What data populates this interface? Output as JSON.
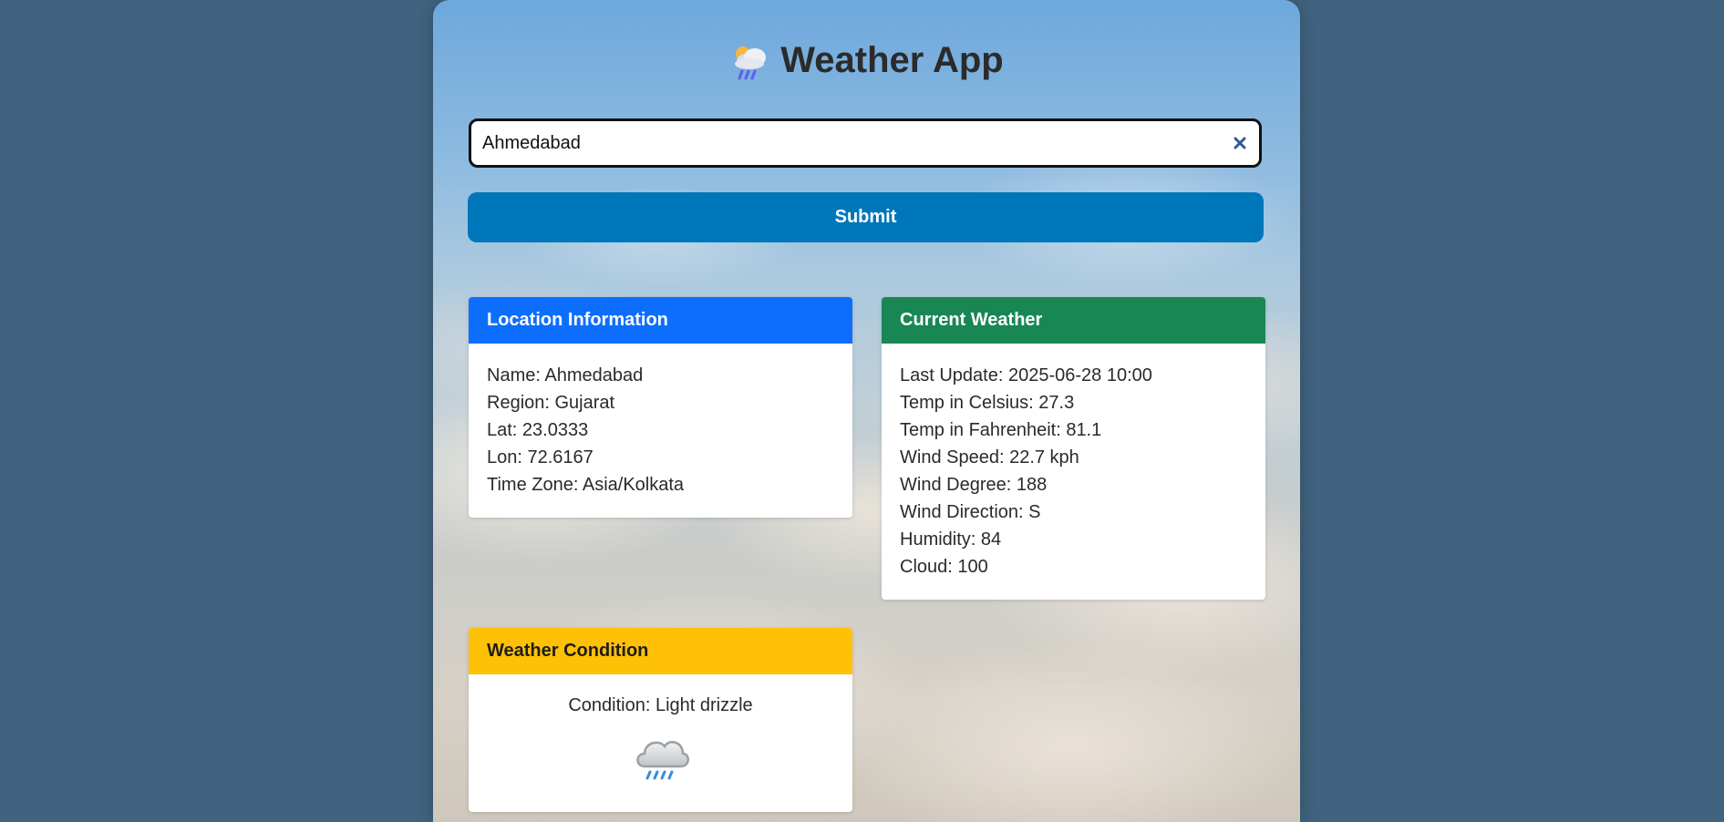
{
  "header": {
    "logo_icon": "cloud-rain-sun-icon",
    "title": "Weather App"
  },
  "search": {
    "value": "Ahmedabad",
    "clear_icon": "close-icon",
    "clear_color": "#2c5a97"
  },
  "submit": {
    "label": "Submit",
    "color": "#0077bb"
  },
  "location_card": {
    "title": "Location Information",
    "color": "#0d6efd",
    "name": "Name: Ahmedabad",
    "region": "Region: Gujarat",
    "lat": "Lat: 23.0333",
    "lon": "Lon: 72.6167",
    "timezone": "Time Zone: Asia/Kolkata"
  },
  "current_card": {
    "title": "Current Weather",
    "color": "#198754",
    "last_update": "Last Update: 2025-06-28 10:00",
    "temp_c": "Temp in Celsius: 27.3",
    "temp_f": "Temp in Fahrenheit: 81.1",
    "wind_speed": "Wind Speed: 22.7 kph",
    "wind_degree": "Wind Degree: 188",
    "wind_direction": "Wind Direction: S",
    "humidity": "Humidity: 84",
    "cloud": "Cloud: 100"
  },
  "condition_card": {
    "title": "Weather Condition",
    "color": "#ffc107",
    "condition": "Condition: Light drizzle",
    "icon": "light-drizzle-icon"
  }
}
